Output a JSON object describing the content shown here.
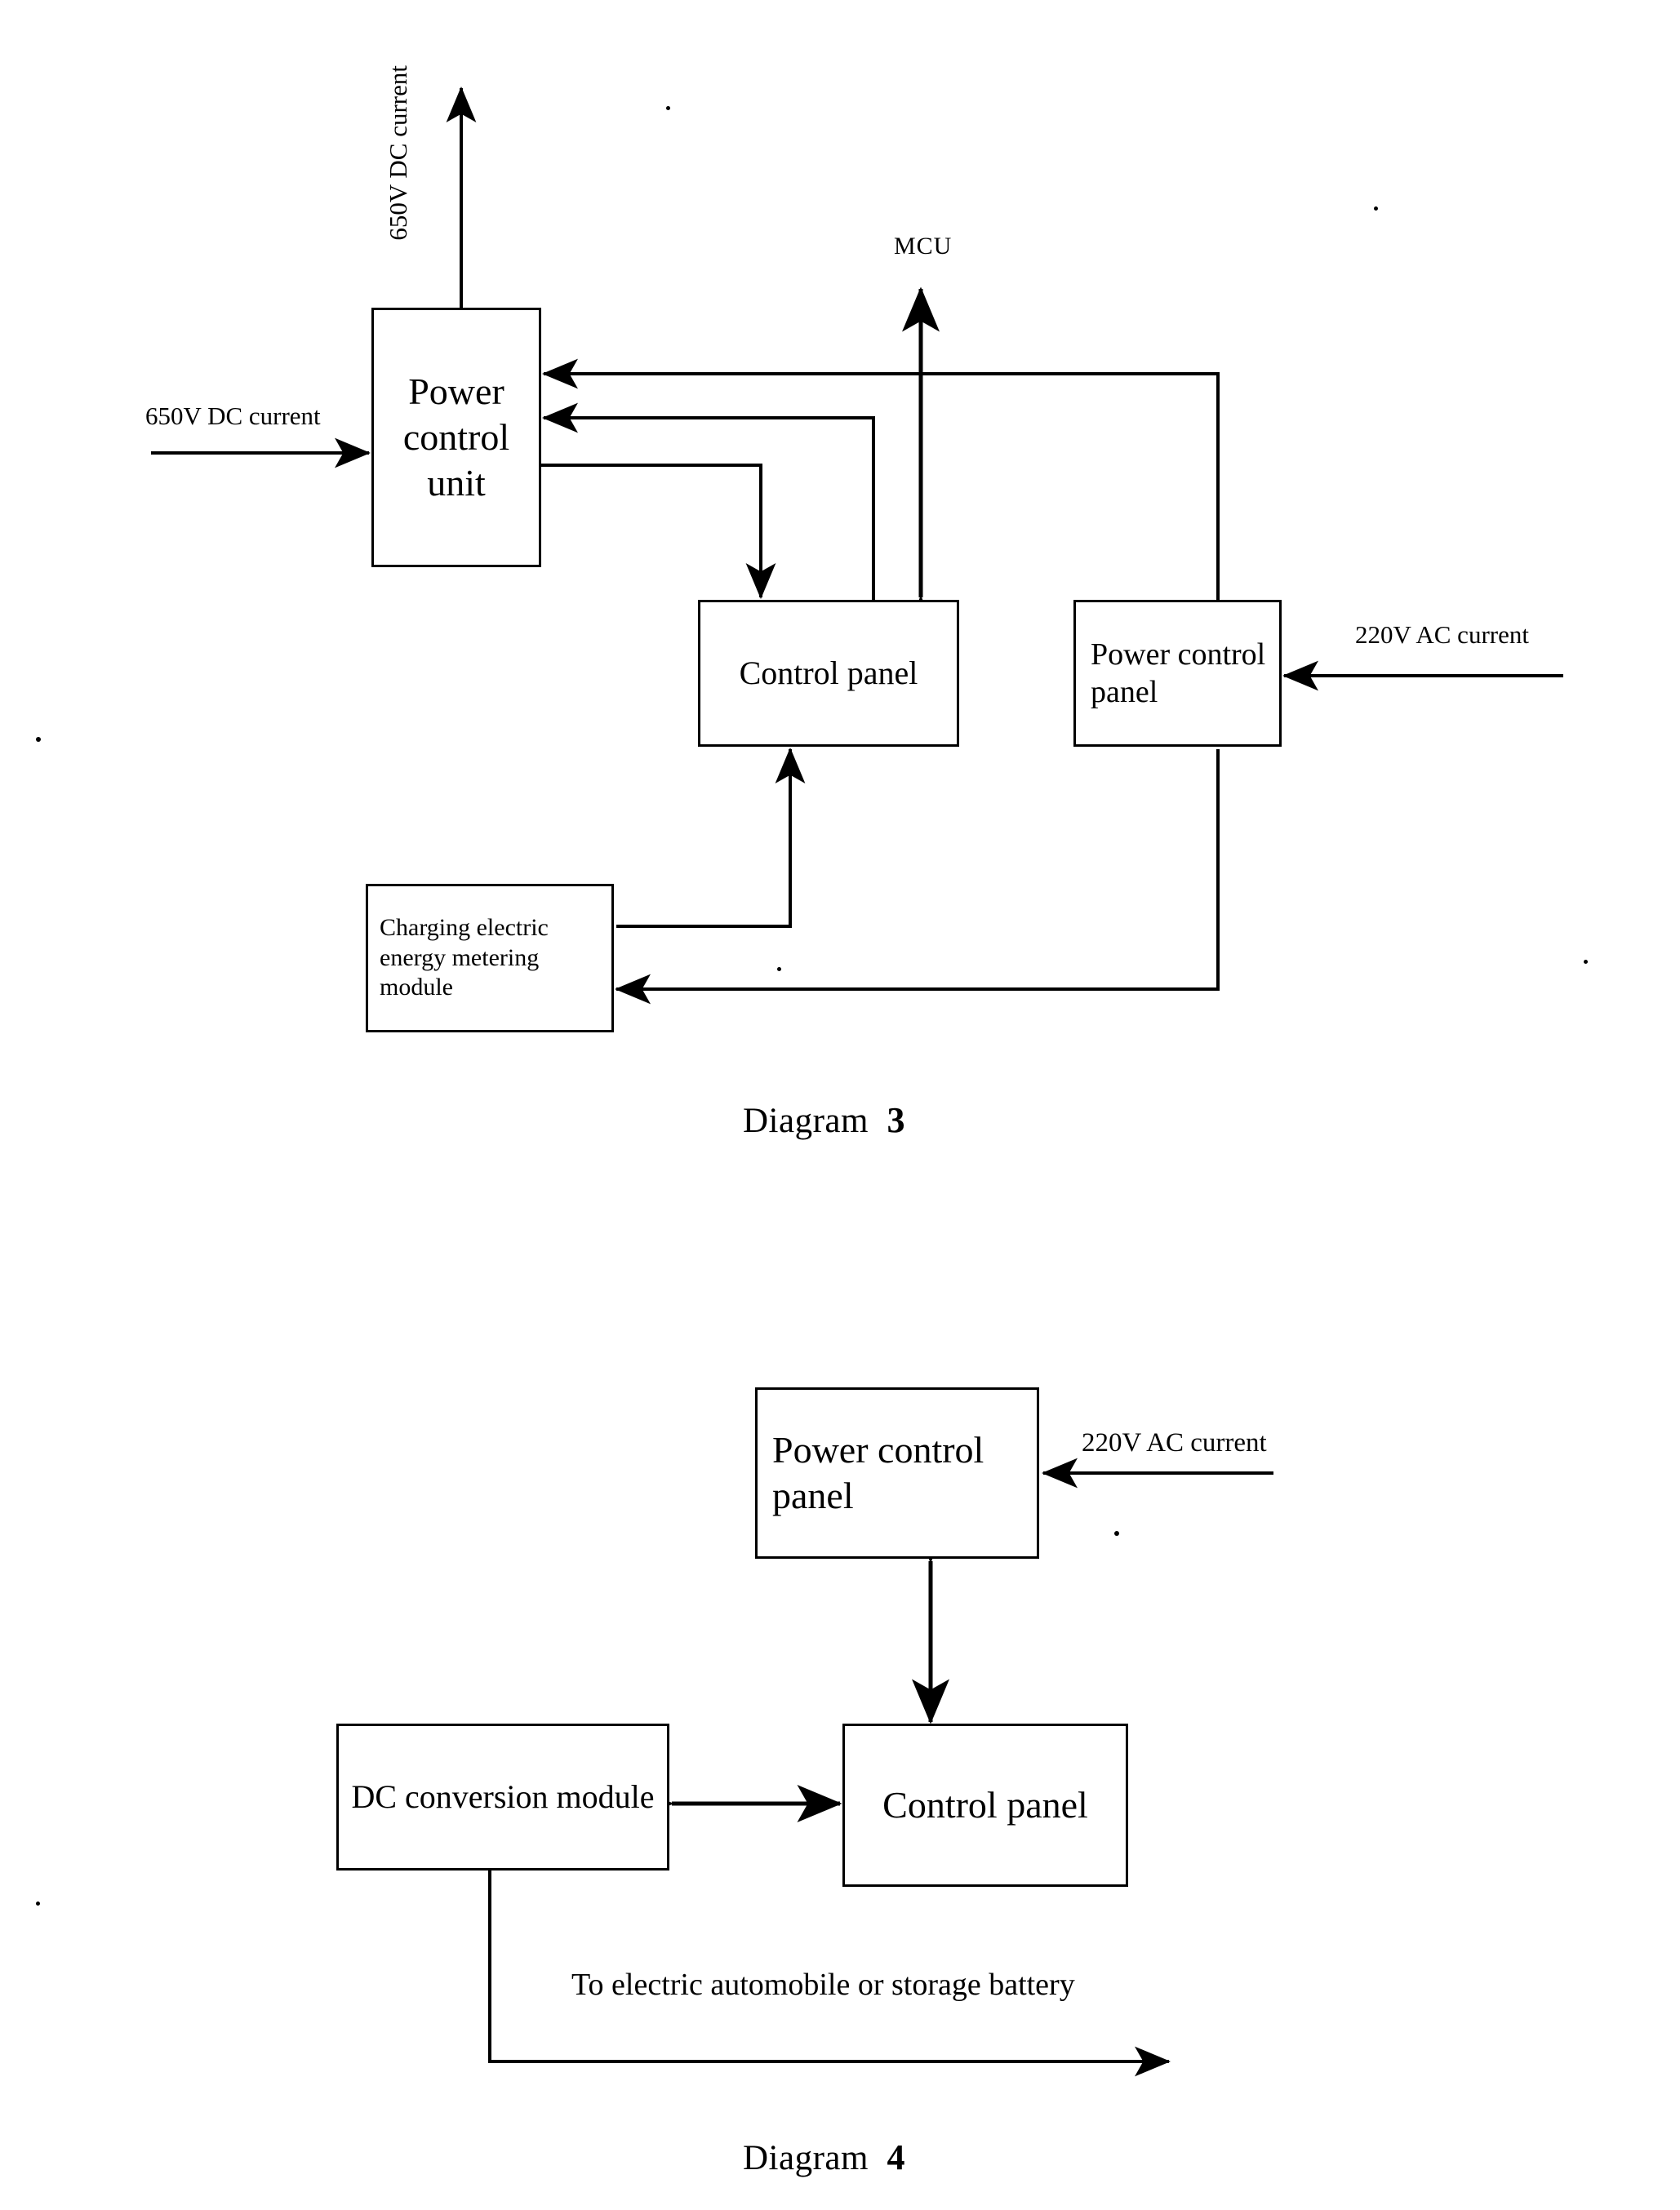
{
  "diagram3": {
    "caption_text": "Diagram",
    "caption_number": "3",
    "nodes": {
      "power_control_unit": "Power control unit",
      "control_panel": "Control panel",
      "power_control_panel": "Power control panel",
      "charging_metering_module": "Charging electric energy metering module"
    },
    "labels": {
      "dc_input": "650V DC current",
      "dc_output_vertical": "650V DC current",
      "mcu": "MCU",
      "ac_input": "220V AC current"
    },
    "connections": [
      {
        "from": "650V DC current input",
        "to": "power_control_unit",
        "type": "arrow"
      },
      {
        "from": "power_control_unit",
        "to": "650V DC current output",
        "type": "arrow"
      },
      {
        "from": "power_control_panel",
        "to": "power_control_unit",
        "type": "arrow"
      },
      {
        "from": "control_panel",
        "to": "power_control_unit",
        "type": "arrow"
      },
      {
        "from": "power_control_unit",
        "to": "control_panel",
        "type": "arrow"
      },
      {
        "from": "control_panel",
        "to": "MCU",
        "type": "double-arrow"
      },
      {
        "from": "220V AC current",
        "to": "power_control_panel",
        "type": "arrow"
      },
      {
        "from": "charging_metering_module",
        "to": "control_panel",
        "type": "arrow"
      },
      {
        "from": "power_control_panel",
        "to": "charging_metering_module",
        "type": "arrow"
      }
    ]
  },
  "diagram4": {
    "caption_text": "Diagram",
    "caption_number": "4",
    "nodes": {
      "power_control_panel": "Power control panel",
      "dc_conversion_module": "DC conversion module",
      "control_panel": "Control panel"
    },
    "labels": {
      "ac_input": "220V AC current",
      "output": "To electric automobile or storage battery"
    },
    "connections": [
      {
        "from": "220V AC current",
        "to": "power_control_panel",
        "type": "arrow"
      },
      {
        "from": "power_control_panel",
        "to": "control_panel",
        "type": "double-arrow"
      },
      {
        "from": "dc_conversion_module",
        "to": "control_panel",
        "type": "double-arrow"
      },
      {
        "from": "dc_conversion_module",
        "to": "output",
        "type": "arrow"
      }
    ]
  },
  "style": {
    "line_color": "#000000",
    "background": "#ffffff"
  }
}
